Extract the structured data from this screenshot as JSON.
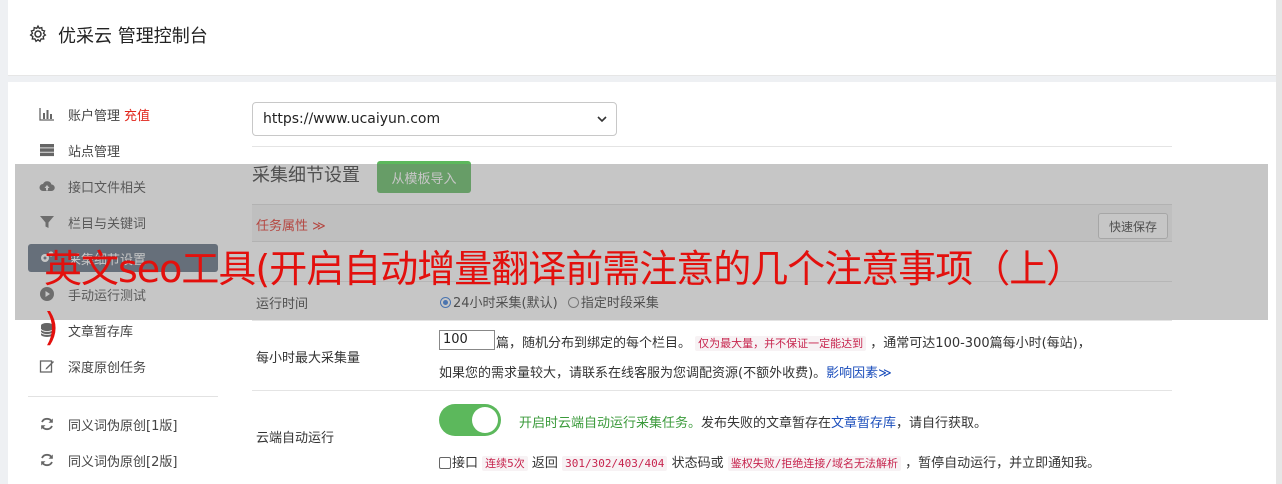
{
  "header": {
    "title": "优采云 管理控制台",
    "icon": "gear-icon"
  },
  "sidebar": {
    "items": [
      {
        "label": "账户管理",
        "tag": "充值",
        "icon": "bar-chart-icon"
      },
      {
        "label": "站点管理",
        "icon": "server-icon"
      },
      {
        "label": "接口文件相关",
        "icon": "cloud-upload-icon"
      },
      {
        "label": "栏目与关键词",
        "icon": "filter-icon"
      },
      {
        "label": "采集细节设置",
        "icon": "gears-icon"
      },
      {
        "label": "手动运行测试",
        "icon": "play-icon"
      },
      {
        "label": "文章暂存库",
        "icon": "database-icon"
      },
      {
        "label": "深度原创任务",
        "icon": "edit-icon"
      },
      {
        "label": "同义词伪原创[1版]",
        "icon": "refresh-icon"
      },
      {
        "label": "同义词伪原创[2版]",
        "icon": "refresh-icon"
      }
    ]
  },
  "site_select": {
    "value": "https://www.ucaiyun.com"
  },
  "section": {
    "title": "采集细节设置",
    "import_button": "从模板导入",
    "attributes_label": "任务属性 ≫",
    "quick_save": "快速保存"
  },
  "rows": {
    "runtime": {
      "label": "运行时间",
      "option1": "24小时采集(默认)",
      "option2": "指定时段采集",
      "selected": "option1"
    },
    "hourly": {
      "label": "每小时最大采集量",
      "value": "100",
      "text1": "篇，随机分布到绑定的每个栏目。",
      "code1": "仅为最大量，并不保证一定能达到",
      "text2": "，通常可达100-300篇每小时(每站)，",
      "text3": "如果您的需求量较大，请联系在线客服为您调配资源(不额外收费)。",
      "link": "影响因素≫"
    },
    "cloud": {
      "label": "云端自动运行",
      "toggle_on": true,
      "green_text": "开启时云端自动运行采集任务。",
      "text1": "发布失败的文章暂存在",
      "link": "文章暂存库",
      "text2": "，请自行获取。",
      "check_label": "接口",
      "code1": "连续5次",
      "text3": "返回",
      "code2": "301/302/403/404",
      "text4": "状态码或",
      "code3": "鉴权失败/拒绝连接/域名无法解析",
      "text5": "，暂停自动运行，并立即通知我。"
    }
  },
  "overlay": {
    "title_line1": "英文seo工具(开启自动增量翻译前需注意的几个注意事项（上）",
    "title_line2": ")"
  },
  "colors": {
    "accent_green": "#5cb85c",
    "alert_red": "#e1251b",
    "sidebar_active": "#5a6a7d"
  }
}
